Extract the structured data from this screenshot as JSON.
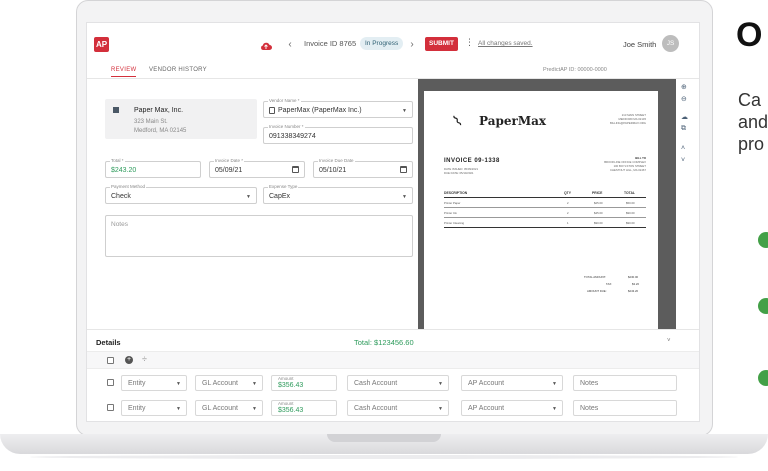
{
  "header": {
    "logo": "AP",
    "invoice_id": "Invoice ID 8765",
    "status": "In Progress",
    "submit_label": "SUBMIT",
    "saved_text": "All changes saved.",
    "user_name": "Joe Smith",
    "user_initials": "JS"
  },
  "tabs": [
    {
      "label": "REVIEW",
      "active": true
    },
    {
      "label": "VENDOR HISTORY",
      "active": false
    }
  ],
  "predict_id": "PredictAP ID: 00000-0000",
  "vendor": {
    "name": "Paper Max, Inc.",
    "street": "323 Main St.",
    "city": "Medford, MA 02145"
  },
  "form": {
    "vendor_name_label": "Vendor Name *",
    "vendor_name_value": "PaperMax (PaperMax Inc.)",
    "invoice_number_label": "Invoice Number *",
    "invoice_number_value": "091338349274",
    "total_label": "Total *",
    "total_value": "$243.20",
    "invoice_date_label": "Invoice Date *",
    "invoice_date_value": "05/09/21",
    "due_date_label": "Invoice Due Date",
    "due_date_value": "05/10/21",
    "payment_method_label": "Payment Method",
    "payment_method_value": "Check",
    "expense_type_label": "Expense Type",
    "expense_type_value": "CapEx",
    "notes_placeholder": "Notes"
  },
  "invoice_doc": {
    "brand": "PaperMax",
    "address_lines": [
      "213 MAIN STREET",
      "MEDFORD MA 02145",
      "BILLING@PAPERMAX.ORG"
    ],
    "title": "INVOICE 09-1338",
    "meta_lines": [
      "DATE ISSUED: 05/09/2021",
      "DUE DATE: 05/10/2021"
    ],
    "bill_to": [
      "BILL TO",
      "BROOKLINE OFFICE COMPLEX",
      "100 BOYLSTON STREET",
      "CHESTNUT HILL, MA 02467"
    ],
    "columns": [
      "DESCRIPTION",
      "QTY",
      "PRICE",
      "TOTAL"
    ],
    "rows": [
      {
        "desc": "Printer Paper",
        "qty": "2",
        "price": "$25.00",
        "total": "$50.00"
      },
      {
        "desc": "Printer Ink",
        "qty": "2",
        "price": "$45.00",
        "total": "$90.00"
      },
      {
        "desc": "Printer Cleaning",
        "qty": "1",
        "price": "$90.00",
        "total": "$90.00"
      }
    ],
    "totals": [
      {
        "label": "TOTAL AMOUNT:",
        "value": "$230.00"
      },
      {
        "label": "TAX:",
        "value": "$3.20"
      },
      {
        "label": "AMOUNT DUE:",
        "value": "$243.20"
      }
    ]
  },
  "details": {
    "title": "Details",
    "total": "Total: $123456.60",
    "amount_label": "Amount",
    "lines": [
      {
        "entity": "Entity",
        "gl": "GL Account",
        "amount": "$356.43",
        "cash": "Cash Account",
        "ap": "AP Account",
        "notes": "Notes"
      },
      {
        "entity": "Entity",
        "gl": "GL Account",
        "amount": "$356.43",
        "cash": "Cash Account",
        "ap": "AP Account",
        "notes": "Notes"
      }
    ]
  },
  "hero": {
    "letter": "O",
    "lines": [
      "Ca",
      "and",
      "pro"
    ]
  },
  "colors": {
    "accent": "#d32f3b",
    "positive": "#2e9b5c",
    "status_bg": "#e3eef3"
  }
}
